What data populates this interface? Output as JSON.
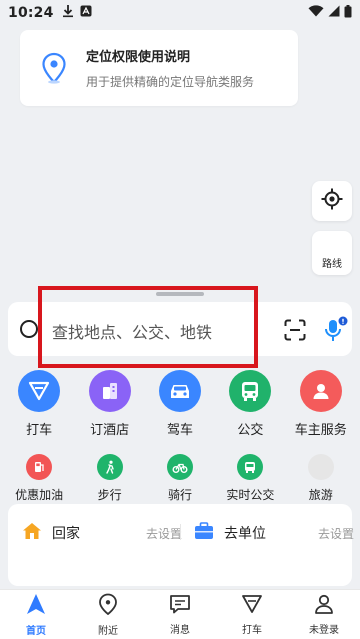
{
  "status_bar": {
    "time": "10:24"
  },
  "permission_card": {
    "title": "定位权限使用说明",
    "description": "用于提供精确的定位导航类服务"
  },
  "map_controls": {
    "route_label": "路线"
  },
  "search": {
    "placeholder": "查找地点、公交、地铁"
  },
  "services_primary": [
    {
      "label": "打车",
      "icon": "taxi-icon",
      "color": "#3a86ff"
    },
    {
      "label": "订酒店",
      "icon": "hotel-icon",
      "color": "#8a63f6"
    },
    {
      "label": "驾车",
      "icon": "car-icon",
      "color": "#3a86ff"
    },
    {
      "label": "公交",
      "icon": "bus-icon",
      "color": "#20b26b"
    },
    {
      "label": "车主服务",
      "icon": "car-owner-icon",
      "color": "#f45b5b"
    }
  ],
  "services_secondary": [
    {
      "label": "优惠加油",
      "icon": "fuel-icon",
      "color": "#f25555"
    },
    {
      "label": "步行",
      "icon": "walk-icon",
      "color": "#1fb46b"
    },
    {
      "label": "骑行",
      "icon": "bike-icon",
      "color": "#1fb46b"
    },
    {
      "label": "实时公交",
      "icon": "realtime-bus-icon",
      "color": "#1fb46b"
    },
    {
      "label": "旅游",
      "icon": "travel-icon",
      "color": "#e6e6e6"
    }
  ],
  "shortcuts": {
    "home": {
      "label": "回家",
      "action": "去设置"
    },
    "work": {
      "label": "去单位",
      "action": "去设置"
    }
  },
  "tabs": [
    {
      "label": "首页",
      "icon": "home-nav-icon"
    },
    {
      "label": "附近",
      "icon": "nearby-icon"
    },
    {
      "label": "消息",
      "icon": "message-icon"
    },
    {
      "label": "打车",
      "icon": "taxi-tab-icon"
    },
    {
      "label": "未登录",
      "icon": "user-icon"
    }
  ],
  "colors": {
    "accent": "#2f7bff",
    "highlight": "#d8161d"
  }
}
